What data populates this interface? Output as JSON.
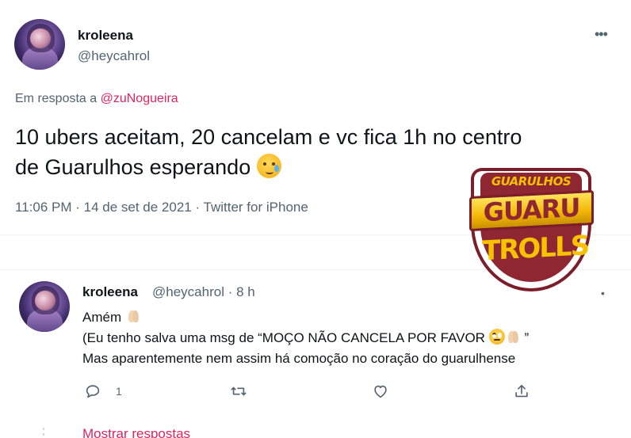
{
  "main_tweet": {
    "display_name": "kroleena",
    "handle": "@heycahrol",
    "more_icon": "more-horizontal-icon",
    "reply_context_prefix": "Em resposta a",
    "reply_context_mention": "@zuNogueira",
    "text_line_1": "10 ubers aceitam, 20 cancelam e vc fica 1h no centro",
    "text_line_2": "de Guarulhos esperando",
    "emoji": "face-holding-back-tears",
    "meta": "11:06 PM · 14 de set de 2021 · Twitter for iPhone"
  },
  "reply_tweet": {
    "display_name": "kroleena",
    "handle_time": "@heycahrol · 8 h",
    "line_1": "Amém",
    "line_2": "(Eu tenho salva uma msg de “MOÇO NÃO CANCELA POR FAVOR",
    "line_2_end": "”",
    "line_3": "Mas aparentemente nem assim há comoção no coração do guarulhense",
    "more_icon": "more-dot-icon",
    "actions": {
      "reply_count": "1",
      "retweet_count": "",
      "like_count": ""
    },
    "show_replies": "Mostrar respostas"
  },
  "watermark": {
    "top": "GUARULHOS",
    "middle": "GUARU",
    "bottom": "TROLLS"
  },
  "colors": {
    "text": "#0f1419",
    "muted": "#536471",
    "accent": "#e0245e",
    "divider": "#eff3f4",
    "watermark_red": "#8f2733",
    "watermark_gold": "#f6c200"
  }
}
